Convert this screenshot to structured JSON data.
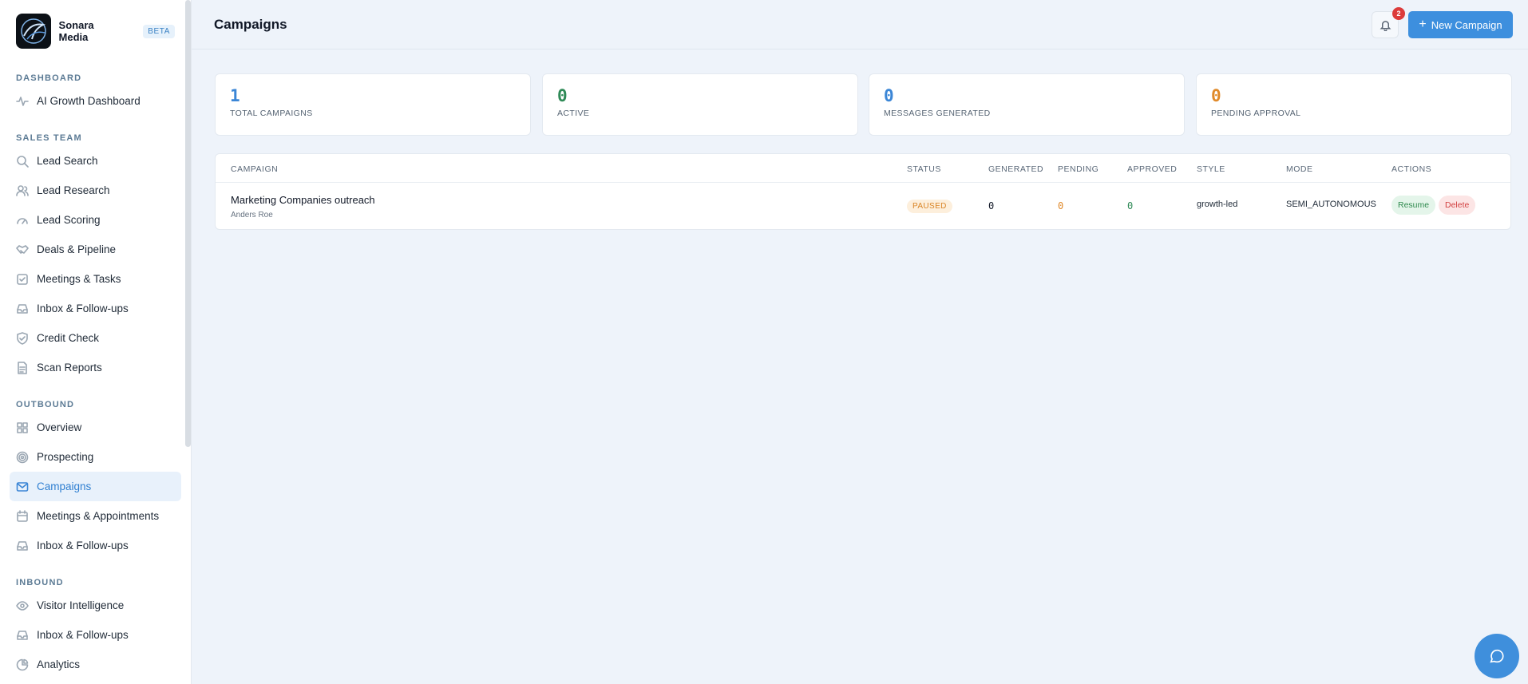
{
  "brand": {
    "name": "Sonara Media",
    "badge": "BETA"
  },
  "sidebar": {
    "sections": [
      {
        "title": "DASHBOARD",
        "items": [
          {
            "label": "AI Growth Dashboard",
            "icon": "activity-icon"
          }
        ]
      },
      {
        "title": "SALES TEAM",
        "items": [
          {
            "label": "Lead Search",
            "icon": "search-icon"
          },
          {
            "label": "Lead Research",
            "icon": "users-icon"
          },
          {
            "label": "Lead Scoring",
            "icon": "gauge-icon"
          },
          {
            "label": "Deals & Pipeline",
            "icon": "handshake-icon"
          },
          {
            "label": "Meetings & Tasks",
            "icon": "checkbox-icon"
          },
          {
            "label": "Inbox & Follow-ups",
            "icon": "inbox-icon"
          },
          {
            "label": "Credit Check",
            "icon": "shield-check-icon"
          },
          {
            "label": "Scan Reports",
            "icon": "document-icon"
          }
        ]
      },
      {
        "title": "OUTBOUND",
        "items": [
          {
            "label": "Overview",
            "icon": "grid-icon"
          },
          {
            "label": "Prospecting",
            "icon": "target-icon"
          },
          {
            "label": "Campaigns",
            "icon": "mail-icon",
            "active": true
          },
          {
            "label": "Meetings & Appointments",
            "icon": "calendar-icon"
          },
          {
            "label": "Inbox & Follow-ups",
            "icon": "inbox-icon"
          }
        ]
      },
      {
        "title": "INBOUND",
        "items": [
          {
            "label": "Visitor Intelligence",
            "icon": "eye-icon"
          },
          {
            "label": "Inbox & Follow-ups",
            "icon": "inbox-icon"
          },
          {
            "label": "Analytics",
            "icon": "pie-chart-icon"
          }
        ]
      }
    ]
  },
  "header": {
    "title": "Campaigns",
    "notifications": "2",
    "new_button": "New Campaign"
  },
  "stats": [
    {
      "value": "1",
      "label": "TOTAL CAMPAIGNS",
      "color": "#3b86d6"
    },
    {
      "value": "0",
      "label": "ACTIVE",
      "color": "#2f8a57"
    },
    {
      "value": "0",
      "label": "MESSAGES GENERATED",
      "color": "#3b86d6"
    },
    {
      "value": "0",
      "label": "PENDING APPROVAL",
      "color": "#e08a2a"
    }
  ],
  "table": {
    "columns": [
      "CAMPAIGN",
      "STATUS",
      "GENERATED",
      "PENDING",
      "APPROVED",
      "STYLE",
      "MODE",
      "ACTIONS"
    ],
    "rows": [
      {
        "name": "Marketing Companies outreach",
        "owner": "Anders Roe",
        "status": "PAUSED",
        "generated": "0",
        "pending": "0",
        "approved": "0",
        "style": "growth-led",
        "mode": "SEMI_AUTONOMOUS",
        "actions": [
          "Resume",
          "Delete"
        ]
      }
    ]
  },
  "colors": {
    "accent": "#3d8fde",
    "paused": "#d98425",
    "pending": "#e08a2a",
    "approved": "#2f8a57"
  }
}
